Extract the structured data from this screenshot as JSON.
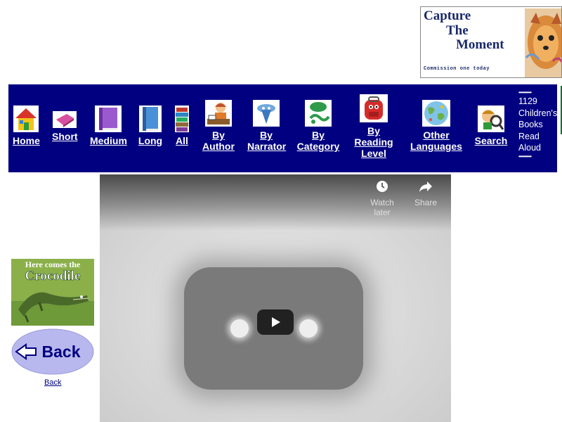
{
  "ad": {
    "line1": "Capture",
    "line2": "The",
    "line3": "Moment",
    "tagline": "Commission one today"
  },
  "nav": {
    "items": [
      {
        "label": "Home",
        "icon": "house-icon"
      },
      {
        "label": "Short",
        "icon": "short-book-icon"
      },
      {
        "label": "Medium",
        "icon": "medium-book-icon"
      },
      {
        "label": "Long",
        "icon": "long-book-icon"
      },
      {
        "label": "All",
        "icon": "book-stack-icon"
      },
      {
        "label": "By Author",
        "icon": "author-icon"
      },
      {
        "label": "By Narrator",
        "icon": "narrator-icon"
      },
      {
        "label": "By Category",
        "icon": "category-icon"
      },
      {
        "label": "By Reading Level",
        "icon": "backpack-icon"
      },
      {
        "label": "Other Languages",
        "icon": "globe-icon"
      },
      {
        "label": "Search",
        "icon": "search-kid-icon"
      }
    ],
    "count_text": [
      "1129",
      "Children's",
      "Books",
      "Read",
      "Aloud"
    ],
    "dots": "••••••••••"
  },
  "book": {
    "title_line1": "Here comes the",
    "title_line2": "Crocodile"
  },
  "back": {
    "button_text": "Back",
    "link_text": "Back"
  },
  "video": {
    "watch_later": "Watch later",
    "share": "Share"
  },
  "colors": {
    "nav_bg": "#000080",
    "back_button": "#b8b8ee",
    "ad_text": "#1a2a6c"
  }
}
